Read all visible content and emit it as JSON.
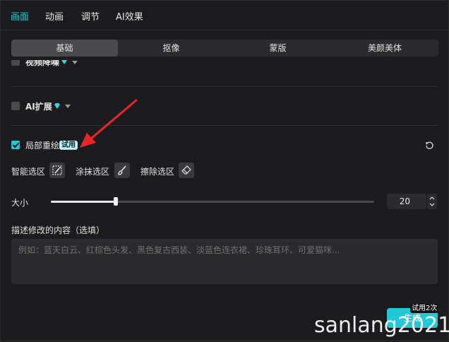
{
  "top_tabs": [
    "画面",
    "动画",
    "调节",
    "AI效果"
  ],
  "sub_tabs": [
    "基础",
    "抠像",
    "蒙版",
    "美颜美体"
  ],
  "options": {
    "video_denoise": "视频降噪",
    "ai_expand": "AI扩展",
    "partial_redraw": "局部重绘",
    "trial_badge": "试用"
  },
  "tools": {
    "smart_select": "智能选区",
    "paint_select": "涂抹选区",
    "erase_select": "擦除选区"
  },
  "size": {
    "label": "大小",
    "value": "20",
    "slider_fraction": 0.2
  },
  "description": {
    "label": "描述修改的内容（选填）",
    "placeholder": "例如：蓝天白云、红棕色头发、黑色复古西装、淡蓝色连衣裙、珍珠耳环、可爱猫咪..."
  },
  "generate": {
    "label": "生成",
    "trial_tag": "试用2次"
  },
  "watermark": "sanlang2021",
  "colors": {
    "accent": "#21c8d6",
    "arrow": "#e8262a"
  }
}
